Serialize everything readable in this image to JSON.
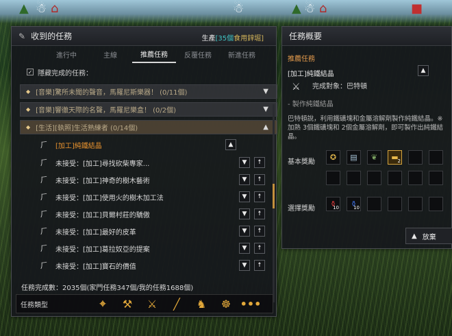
{
  "quest_window": {
    "title": "收到的任務",
    "production_prefix": "生產",
    "production_highlight": "[35個",
    "production_rest": "食用鋅堀]",
    "tabs": [
      {
        "label": "進行中",
        "active": false
      },
      {
        "label": "主線",
        "active": false
      },
      {
        "label": "推薦任務",
        "active": true
      },
      {
        "label": "反覆任務",
        "active": false
      },
      {
        "label": "新進任務",
        "active": false
      }
    ],
    "hide_completed_label": "隱藏完成的任務：",
    "groups": [
      {
        "label": "[音樂]驚所未聞的聲音，馬羅尼斯樂器！ (0/11個)",
        "expanded": false
      },
      {
        "label": "[音樂]響徹天際的名聲，馬羅尼樂盒！ (0/2個)",
        "expanded": false
      },
      {
        "label": "[生活][執照]生活熟練者 (0/14個)",
        "expanded": true
      }
    ],
    "quests": [
      {
        "label": "[加工]純鐵結晶",
        "state": "active"
      },
      {
        "label": "未接受：[加工]尋找砍柴專家...",
        "state": "unaccepted"
      },
      {
        "label": "未接受：[加工]神奇的樹木藝術",
        "state": "unaccepted"
      },
      {
        "label": "未接受：[加工]使用火的樹木加工法",
        "state": "unaccepted"
      },
      {
        "label": "未接受：[加工]貝爾村莊的驕傲",
        "state": "unaccepted"
      },
      {
        "label": "未接受：[加工]最好的皮革",
        "state": "unaccepted"
      },
      {
        "label": "未接受：[加工]葛拉奴亞的提案",
        "state": "unaccepted"
      },
      {
        "label": "未接受：[加工]寶石的價值",
        "state": "unaccepted"
      }
    ],
    "completion_count": "任務完成數：2035個(家門任務347個/我的任務1688個)",
    "type_label": "任務類型",
    "type_icons": [
      "crosshair-icon",
      "hammer-axe-icon",
      "crossed-swords-icon",
      "staff-icon",
      "horse-icon",
      "wheel-icon",
      "more-icon"
    ]
  },
  "summary_window": {
    "title": "任務概要",
    "section_title": "推薦任務",
    "quest_name": "[加工]純鐵結晶",
    "completion_target": "完成對象：巴特頓",
    "objective": "- 製作純鐵結晶",
    "description": "巴特頓說，利用鐵礦塊和金屬溶解劑製作純鐵結晶。※ 加熱 3個鐵礦塊和 2個金屬溶解劑，即可製作出純鐵結晶。",
    "basic_reward_label": "基本獎勵",
    "choice_reward_label": "選擇獎勵",
    "basic_reward_count": "2",
    "choice_counts": [
      "10",
      "10"
    ],
    "abandon_label": "放棄"
  }
}
